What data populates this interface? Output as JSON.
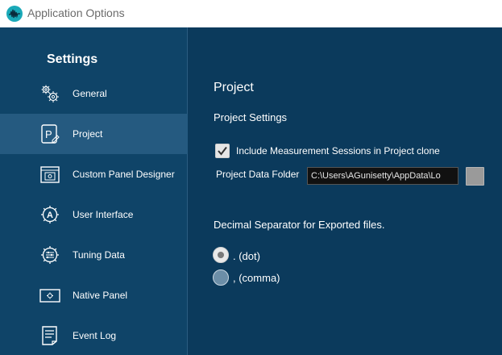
{
  "window": {
    "title": "Application Options"
  },
  "sidebar": {
    "heading": "Settings",
    "items": [
      {
        "label": "General",
        "icon": "gears-icon",
        "active": false
      },
      {
        "label": "Project",
        "icon": "project-icon",
        "active": true
      },
      {
        "label": "Custom Panel Designer",
        "icon": "panel-designer-icon",
        "active": false
      },
      {
        "label": "User Interface",
        "icon": "user-interface-icon",
        "active": false
      },
      {
        "label": "Tuning Data",
        "icon": "tuning-data-icon",
        "active": false
      },
      {
        "label": "Native Panel",
        "icon": "native-panel-icon",
        "active": false
      },
      {
        "label": "Event Log",
        "icon": "event-log-icon",
        "active": false
      }
    ]
  },
  "main": {
    "section_title": "Project",
    "subsection_title": "Project Settings",
    "include_sessions": {
      "label": "Include Measurement Sessions in Project clone",
      "checked": true
    },
    "project_data_folder": {
      "label": "Project Data Folder",
      "value": "C:\\Users\\AGunisetty\\AppData\\Lo"
    },
    "decimal_separator": {
      "label": "Decimal Separator for Exported files.",
      "options": [
        {
          "label": ". (dot)",
          "selected": true
        },
        {
          "label": ", (comma)",
          "selected": false
        }
      ]
    }
  },
  "colors": {
    "sidebar_bg": "#0f4468",
    "main_bg": "#0b3a5c",
    "active_item_bg": "#255a80",
    "accent": "#00b4c8"
  }
}
